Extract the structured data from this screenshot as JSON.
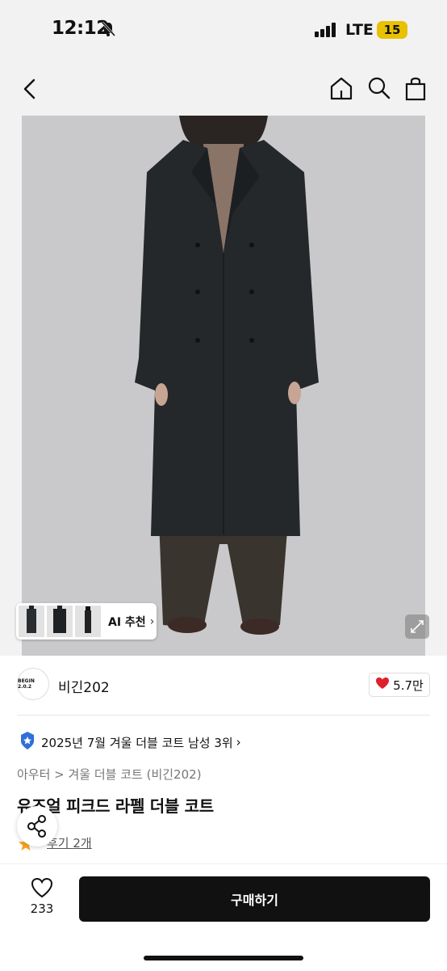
{
  "status_bar": {
    "time": "12:12",
    "network": "LTE",
    "battery": "15"
  },
  "photo": {
    "ai_label": "AI 추천",
    "chevron": "›"
  },
  "brand": {
    "logo_text": "BEGIN 2.0.2",
    "name": "비긴202"
  },
  "likes": {
    "count": "5.7만"
  },
  "ranking": {
    "text": "2025년 7월 겨울 더블 코트 남성 3위",
    "chevron": "›"
  },
  "breadcrumb": {
    "text": "아우터 > 겨울 더블 코트 (비긴202)"
  },
  "product": {
    "title": "유즈얼 피크드 라펠 더블 코트"
  },
  "reviews": {
    "text": "후기 2개"
  },
  "bottom_bar": {
    "wish_count": "233",
    "buy_label": "구매하기"
  },
  "colors": {
    "heart_red": "#e0202b",
    "rank_badge_blue": "#2f6fd6",
    "buy_button": "#111111",
    "star_gold": "#f5a623"
  }
}
